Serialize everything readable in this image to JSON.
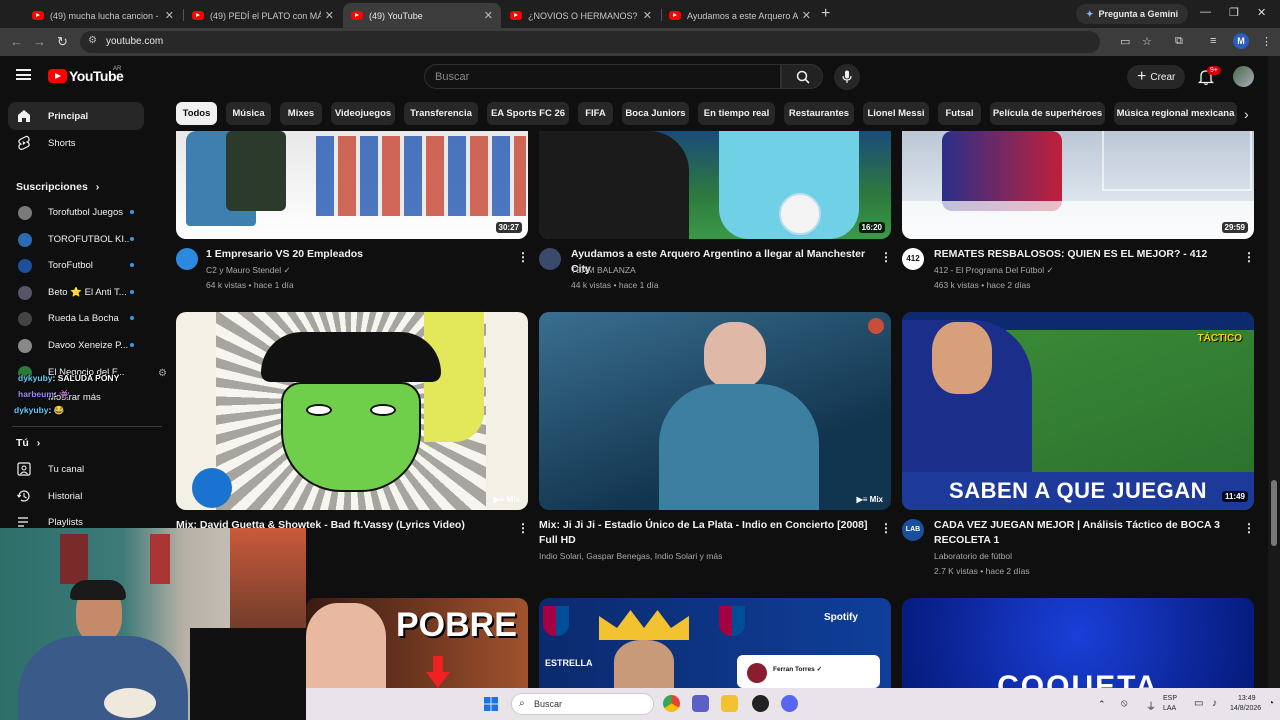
{
  "browser": {
    "tabs": [
      {
        "title": "(49) mucha lucha cancion - You",
        "active": false
      },
      {
        "title": "(49) PEDÍ el PLATO con MÁS C",
        "active": false
      },
      {
        "title": "(49) YouTube",
        "active": true
      },
      {
        "title": "¿NOVIOS O HERMANOS? ft. Ju",
        "active": false
      },
      {
        "title": "Ayudamos a este Arquero Arge",
        "active": false
      }
    ],
    "gemini_label": "Pregunta a Gemini",
    "url": "youtube.com",
    "profile_initial": "M"
  },
  "youtube": {
    "logo_text": "YouTube",
    "country_code": "AR",
    "search_placeholder": "Buscar",
    "create_label": "Crear",
    "notification_count": "9+"
  },
  "sidebar": {
    "main": [
      {
        "label": "Principal",
        "icon": "home-icon",
        "active": true
      },
      {
        "label": "Shorts",
        "icon": "shorts-icon",
        "active": false
      }
    ],
    "subscriptions_heading": "Suscripciones",
    "subscriptions": [
      {
        "label": "Torofutbol Juegos",
        "color": "#7a7a7a"
      },
      {
        "label": "TOROFUTBOL KI...",
        "color": "#2b6cb0"
      },
      {
        "label": "ToroFutbol",
        "color": "#1e4f9a"
      },
      {
        "label": "Beto ⭐ El Anti T...",
        "color": "#556"
      },
      {
        "label": "Rueda La Bocha",
        "color": "#444"
      },
      {
        "label": "Davoo Xeneize P...",
        "color": "#888"
      },
      {
        "label": "El Negocio del F...",
        "color": "#2a7a3a"
      }
    ],
    "show_more": "Mostrar más",
    "you_heading": "Tú",
    "you_items": [
      {
        "label": "Tu canal",
        "icon": "channel-icon"
      },
      {
        "label": "Historial",
        "icon": "history-icon"
      },
      {
        "label": "Playlists",
        "icon": "playlists-icon"
      }
    ]
  },
  "chat": [
    {
      "user": "dykyuby",
      "text": ": SALUDA PONY",
      "color": "#5fd0ff"
    },
    {
      "user": "harbeum",
      "text": ": 👾",
      "color": "#9b8cff"
    },
    {
      "user": "dykyuby",
      "text": ": 😂",
      "color": "#5fd0ff"
    }
  ],
  "chips": [
    "Todos",
    "Música",
    "Mixes",
    "Videojuegos",
    "Transferencia",
    "EA Sports FC 26",
    "FIFA",
    "Boca Juniors",
    "En tiempo real",
    "Restaurantes",
    "Lionel Messi",
    "Futsal",
    "Película de superhéroes",
    "Música regional mexicana"
  ],
  "videos_row1": [
    {
      "title": "1 Empresario VS 20 Empleados",
      "channel": "C2 y Mauro Stendel ✓",
      "meta": "64 k vistas • hace 1 día",
      "duration": "30:27"
    },
    {
      "title": "Ayudamos a este Arquero Argentino a llegar al Manchester City",
      "channel": "TEAM BALANZA",
      "meta": "44 k vistas • hace 1 día",
      "duration": "16:20"
    },
    {
      "title": "REMATES RESBALOSOS: QUIEN ES EL MEJOR? - 412",
      "channel": "412 - El Programa Del Fútbol ✓",
      "meta": "463 k vistas • hace 2 días",
      "duration": "29:59"
    }
  ],
  "videos_row2": [
    {
      "title": "Mix: David Guetta & Showtek - Bad ft.Vassy (Lyrics Video)",
      "channel": "",
      "meta": "",
      "badge": "Mix"
    },
    {
      "title": "Mix: Ji Ji Ji - Estadio Único de La Plata - Indio en Concierto [2008] Full HD",
      "channel": "Indio Solari, Gaspar Benegas, Indio Solari y más",
      "meta": "",
      "badge": "Mix"
    },
    {
      "title": "CADA VEZ JUEGAN MEJOR | Análisis Táctico de BOCA 3 RECOLETA 1",
      "channel": "Laboratorio de fútbol",
      "meta": "2.7 K vistas • hace 2 días",
      "duration": "11:49"
    }
  ],
  "thumb_texts": {
    "boca_caption": "SABEN A QUE JUEGAN",
    "boca_corner": "TÁCTICO",
    "avatar_412": "412",
    "avatar_lab": "LAB",
    "pobre": "POBRE",
    "spotify": "Spotify",
    "estrella": "ESTRELLA",
    "blue_text": "COQUETA"
  },
  "notification_popup": {
    "name": "Ferran Torres ✓"
  },
  "taskbar": {
    "search_label": "Buscar",
    "lang": "ESP",
    "lang2": "LAA",
    "time": "13:49",
    "date": "14/8/2026"
  }
}
